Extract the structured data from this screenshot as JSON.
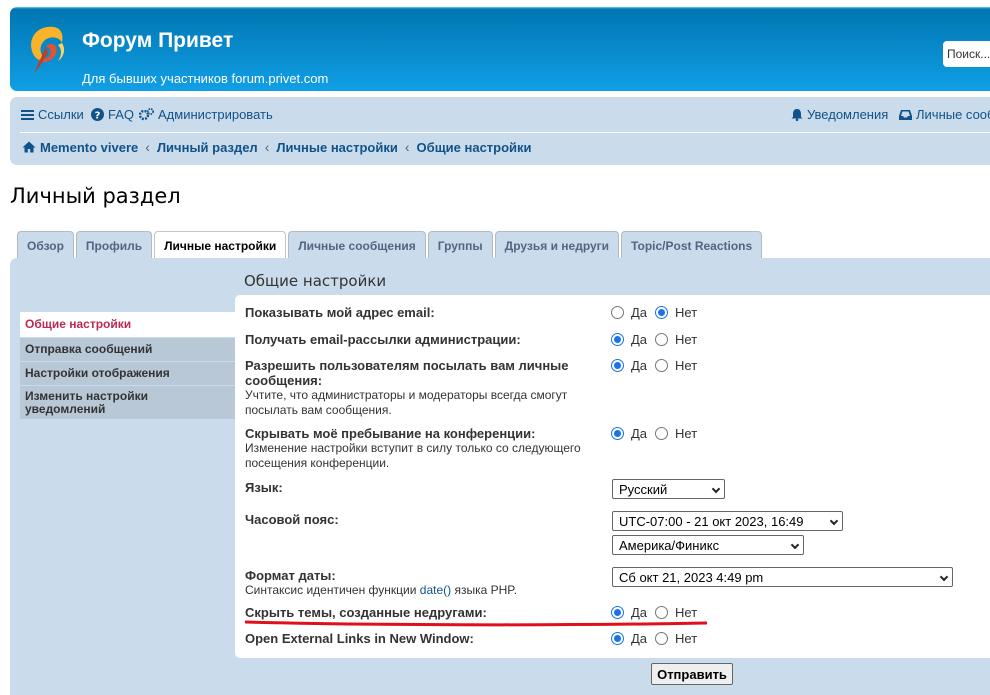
{
  "header": {
    "title": "Форум Привет",
    "description": "Для бывших участников forum.privet.com",
    "search_placeholder": "Поиск..."
  },
  "navbar": {
    "links": {
      "links_label": "Ссылки",
      "faq_label": "FAQ",
      "admin_label": "Администрировать",
      "notifications_label": "Уведомления",
      "personal_label": "Личные сообщения"
    },
    "breadcrumbs": [
      "Memento vivere",
      "Личный раздел",
      "Личные настройки",
      "Общие настройки"
    ]
  },
  "page_title": "Личный раздел",
  "tabs": [
    "Обзор",
    "Профиль",
    "Личные настройки",
    "Личные сообщения",
    "Группы",
    "Друзья и недруги",
    "Topic/Post Reactions"
  ],
  "active_tab": "Личные настройки",
  "panel_title": "Общие настройки",
  "side_menu": [
    "Общие настройки",
    "Отправка сообщений",
    "Настройки отображения",
    "Изменить настройки уведомлений"
  ],
  "form": {
    "yes_label": "Да",
    "no_label": "Нет",
    "rows": [
      {
        "label": "Показывать мой адрес email:",
        "value": "Нет"
      },
      {
        "label": "Получать email-рассылки администрации:",
        "value": "Да"
      },
      {
        "label": "Разрешить пользователям посылать вам личные сообщения:",
        "explain": "Учтите, что администраторы и модераторы всегда смогут посылать вам сообщения.",
        "value": "Да"
      },
      {
        "label": "Скрывать моё пребывание на конференции:",
        "explain": "Изменение настройки вступит в силу только со следующего посещения конференции.",
        "value": "Да"
      },
      {
        "label": "Язык:"
      },
      {
        "label": "Часовой пояс:"
      },
      {
        "label": "Формат даты:",
        "explain_prefix": "Синтаксис идентичен функции ",
        "explain_code": "date()",
        "explain_suffix": " языка PHP."
      },
      {
        "label": "Скрыть темы, созданные недругами:",
        "value": "Да"
      },
      {
        "label": "Open External Links in New Window:",
        "value": "Да"
      }
    ],
    "language_select": "Русский",
    "timezone_select": "UTC-07:00 - 21 окт 2023, 16:49",
    "region_select": "Америка/Финикс",
    "dateformat_select": "Сб окт 21, 2023 4:49 pm",
    "submit_label": "Отправить"
  },
  "colors": {
    "header_blue": "#12a3eb",
    "nav_bg": "#cadceb",
    "link": "#105289",
    "active_menu": "#bc2a4d",
    "annotation_red": "#e0101a"
  }
}
